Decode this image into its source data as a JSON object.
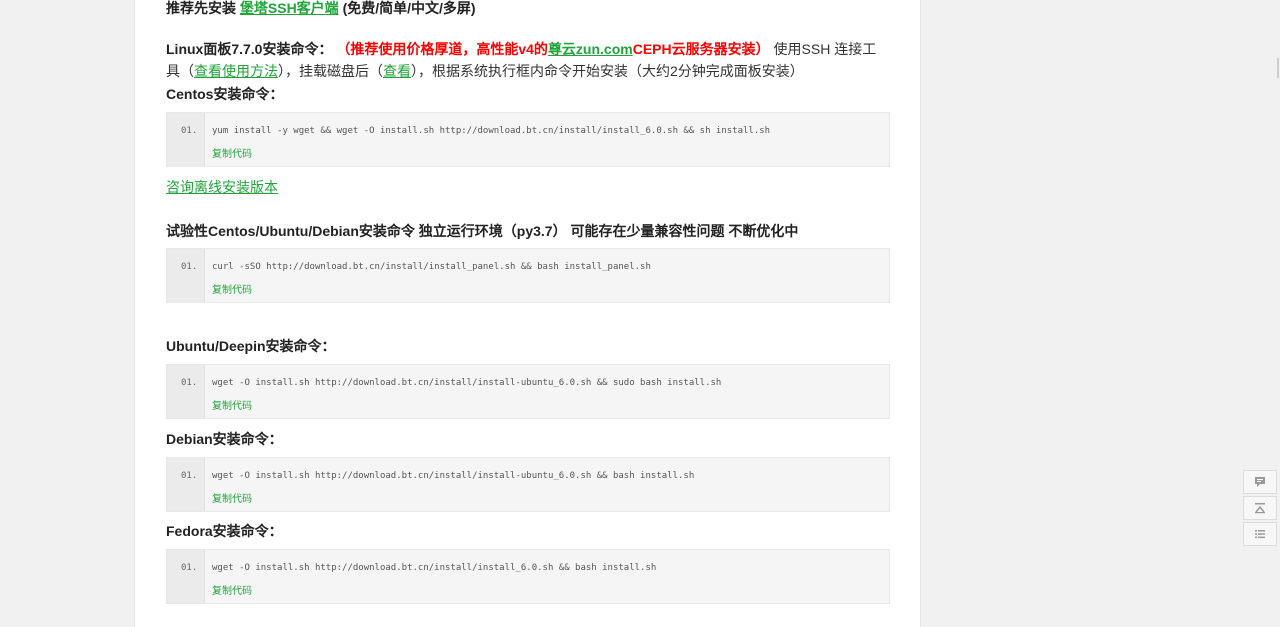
{
  "header": {
    "prefix": "推荐先安装 ",
    "ssh_link": "堡塔SSH客户端",
    "suffix": " (免费/简单/中文/多屏)"
  },
  "linux": {
    "title": "Linux面板7.7.0安装命令：",
    "promo_before": "（推荐使用价格厚道，高性能v4的",
    "promo_link": "尊云zun.com",
    "promo_after": "CEPH云服务器安装）",
    "desc1": "使用SSH 连接工具（",
    "link_method": "查看使用方法",
    "desc2": "），挂载磁盘后（",
    "link_view": "查看",
    "desc3": "），根据系统执行框内命令开始安装（大约2分钟完成面板安装）"
  },
  "sections": [
    {
      "title": "Centos安装命令：",
      "num": "01.",
      "command": "yum install -y wget && wget -O install.sh http://download.bt.cn/install/install_6.0.sh && sh install.sh",
      "copy": "复制代码"
    },
    {
      "title": "试验性Centos/Ubuntu/Debian安装命令 独立运行环境（py3.7） 可能存在少量兼容性问题 不断优化中",
      "num": "01.",
      "command": "curl -sSO http://download.bt.cn/install/install_panel.sh && bash install_panel.sh",
      "copy": "复制代码"
    },
    {
      "title": "Ubuntu/Deepin安装命令：",
      "num": "01.",
      "command": "wget -O install.sh http://download.bt.cn/install/install-ubuntu_6.0.sh && sudo bash install.sh",
      "copy": "复制代码"
    },
    {
      "title": "Debian安装命令：",
      "num": "01.",
      "command": "wget -O install.sh http://download.bt.cn/install/install-ubuntu_6.0.sh && bash install.sh",
      "copy": "复制代码"
    },
    {
      "title": "Fedora安装命令：",
      "num": "01.",
      "command": "wget -O install.sh http://download.bt.cn/install/install_6.0.sh && bash install.sh",
      "copy": "复制代码"
    }
  ],
  "offline_link": "咨询离线安装版本",
  "sidebar_tools": [
    "comment-icon",
    "back-to-top-icon",
    "list-icon"
  ]
}
